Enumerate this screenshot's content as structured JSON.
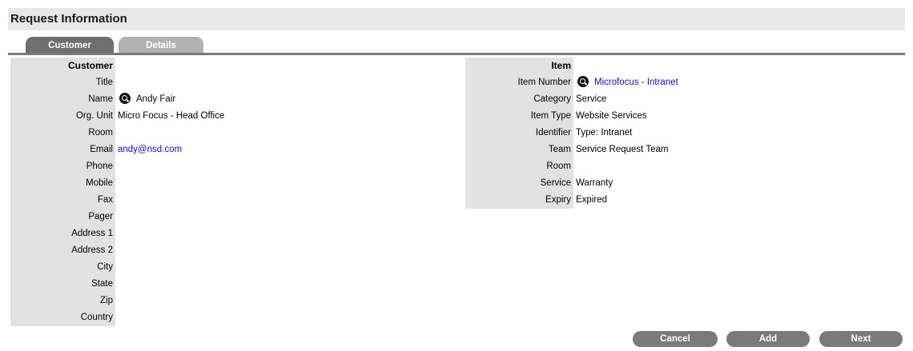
{
  "header": {
    "title": "Request Information"
  },
  "tabs": [
    {
      "label": "Customer"
    },
    {
      "label": "Details"
    }
  ],
  "customer": {
    "section_label": "Customer",
    "rows": [
      {
        "label": "Title",
        "value": ""
      },
      {
        "label": "Name",
        "value": "Andy Fair",
        "icon": "search-icon"
      },
      {
        "label": "Org. Unit",
        "value": "Micro Focus - Head Office"
      },
      {
        "label": "Room",
        "value": ""
      },
      {
        "label": "Email",
        "value": "andy@nsd.com"
      },
      {
        "label": "Phone",
        "value": ""
      },
      {
        "label": "Mobile",
        "value": ""
      },
      {
        "label": "Fax",
        "value": ""
      },
      {
        "label": "Pager",
        "value": ""
      },
      {
        "label": "Address 1",
        "value": ""
      },
      {
        "label": "Address 2",
        "value": ""
      },
      {
        "label": "City",
        "value": ""
      },
      {
        "label": "State",
        "value": ""
      },
      {
        "label": "Zip",
        "value": ""
      },
      {
        "label": "Country",
        "value": ""
      }
    ]
  },
  "item": {
    "section_label": "Item",
    "rows": [
      {
        "label": "Item Number",
        "value": "Microfocus - Intranet",
        "icon": "search-icon"
      },
      {
        "label": "Category",
        "value": "Service"
      },
      {
        "label": "Item Type",
        "value": "Website Services"
      },
      {
        "label": "Identifier",
        "value": "Type: Intranet"
      },
      {
        "label": "Team",
        "value": "Service Request Team"
      },
      {
        "label": "Room",
        "value": ""
      },
      {
        "label": "Service",
        "value": "Warranty"
      },
      {
        "label": "Expiry",
        "value": "Expired"
      }
    ]
  },
  "actions": {
    "cancel_label": "Cancel",
    "add_label": "Add",
    "next_label": "Next"
  },
  "colors": {
    "button_bg": "#7a7a7a",
    "label_bg": "#e2e2e2",
    "header_bg": "#e8e8e8",
    "link": "#1010d0"
  }
}
